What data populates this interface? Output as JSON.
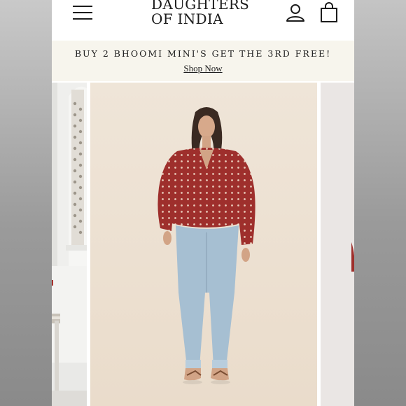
{
  "header": {
    "logo_line1": "DAUGHTERS",
    "logo_line2": "OF INDIA",
    "menu_icon": "hamburger-menu-icon",
    "account_icon": "user-account-icon",
    "bag_icon": "shopping-bag-icon"
  },
  "promo": {
    "text": "BUY 2 BHOOMI MINI'S GET THE 3RD FREE!",
    "link": "Shop Now"
  },
  "carousel": {
    "slides": [
      "previous product image",
      "main product image",
      "next product image"
    ]
  },
  "colors": {
    "header_bg": "#ffffff",
    "promo_bg": "#f7f5ed",
    "text": "#1c1c1c",
    "blouse_red": "#9e2f2c",
    "denim": "#a6bfd2",
    "photo_bg": "#ede3d6"
  }
}
